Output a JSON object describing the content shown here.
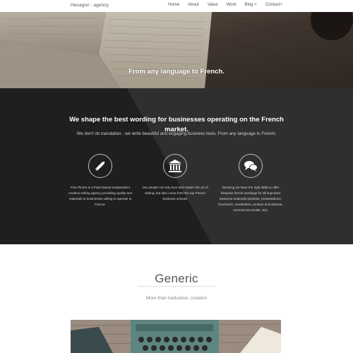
{
  "nav": {
    "brand": "Hexagon : agency",
    "items": [
      "Home",
      "About",
      "Value",
      "Work",
      "Blog +",
      "Contact+"
    ]
  },
  "hero": {
    "title": "From any language to French."
  },
  "intro": {
    "heading": "We shape the best wording for businesses operating on the French market.",
    "subtitle": "We don't do translation - we write beautiful and engaging business texts. From any language to French."
  },
  "features": [
    {
      "icon": "pencil-icon",
      "text": "Fine Plume is a Paris-based independent creative writing agency providing quality text materials to businesses willing to operate in France."
    },
    {
      "icon": "bank-icon",
      "text": "Our people not only love and master the art of writing, but also come from the top French business schools"
    },
    {
      "icon": "chat-bubbles-icon",
      "text": "Meaning we have the right skills to offer bespoke french wordings for all important business materials (website, presentations, brochures, newsletters, product descriptions, commercial emails, etc)."
    }
  ],
  "generic": {
    "title": "Generic",
    "subtitle": "More than traduction, creation"
  },
  "colors": {
    "band_dark": "#222222",
    "band_light": "#2e2e2e",
    "hero_wood": "#5b4e45"
  }
}
